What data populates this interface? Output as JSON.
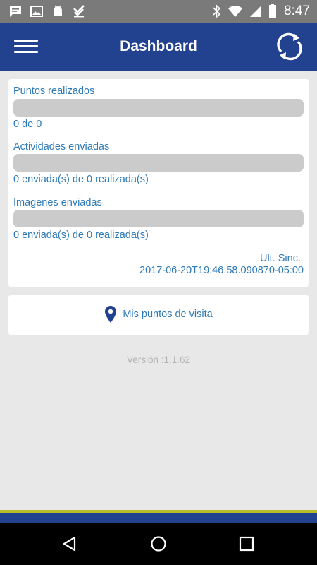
{
  "status_bar": {
    "time": "8:47",
    "icons": [
      "chat-icon",
      "image-icon",
      "android-icon",
      "download-done-icon",
      "bluetooth-icon",
      "wifi-icon",
      "signal-icon",
      "battery-icon"
    ]
  },
  "app_bar": {
    "title": "Dashboard",
    "menu_icon": "hamburger-icon",
    "refresh_icon": "refresh-icon"
  },
  "stats": {
    "puntos": {
      "label": "Puntos realizados",
      "value": "0 de 0",
      "progress": 0
    },
    "actividades": {
      "label": "Actividades enviadas",
      "value": "0 enviada(s) de 0 realizada(s)",
      "progress": 0
    },
    "imagenes": {
      "label": "Imagenes enviadas",
      "value": "0 enviada(s) de 0 realizada(s)",
      "progress": 0
    },
    "sync_label": "Ult. Sinc.",
    "sync_value": "2017-06-20T19:46:58.090870-05:00"
  },
  "visit_button": {
    "label": "Mis puntos de visita",
    "icon": "map-pin-icon"
  },
  "version": "Versión :1.1.62",
  "nav": {
    "back": "back-icon",
    "home": "home-icon",
    "recents": "recents-icon"
  },
  "colors": {
    "primary": "#22418f",
    "accent_text": "#2d79b5",
    "stripe": "#b9bd2a",
    "progress_track": "#cbcbcb"
  }
}
